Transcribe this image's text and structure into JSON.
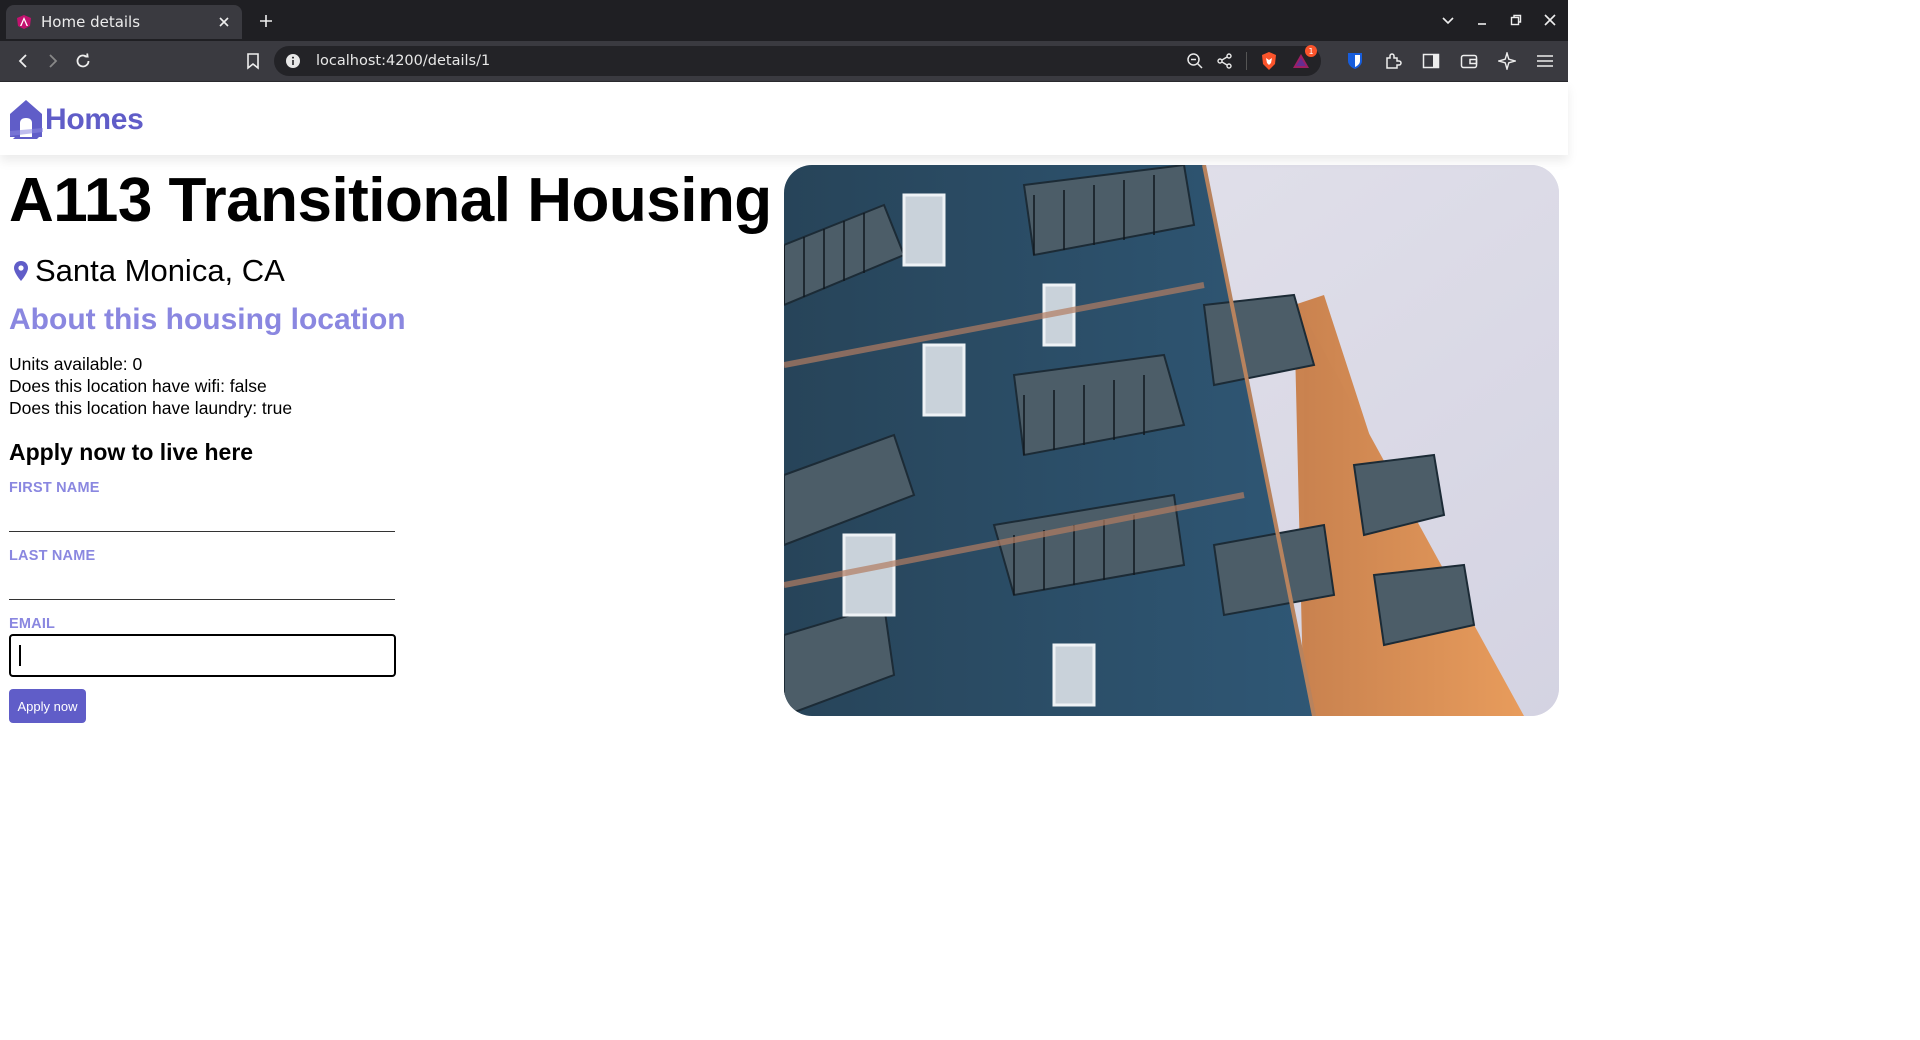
{
  "browser": {
    "tab_title": "Home details",
    "url": "localhost:4200/details/1",
    "brave_badge_count": "1"
  },
  "app": {
    "brand_name": "Homes",
    "accent_color": "#605DC8"
  },
  "listing": {
    "name": "A113 Transitional Housing",
    "location": "Santa Monica, CA",
    "about_heading": "About this housing location",
    "features": [
      "Units available: 0",
      "Does this location have wifi: false",
      "Does this location have laundry: true"
    ],
    "photo_icon": "apartment-building-photo"
  },
  "form": {
    "heading": "Apply now to live here",
    "first_name_label": "FIRST NAME",
    "first_name_value": "",
    "last_name_label": "LAST NAME",
    "last_name_value": "",
    "email_label": "EMAIL",
    "email_value": "",
    "submit_label": "Apply now"
  }
}
